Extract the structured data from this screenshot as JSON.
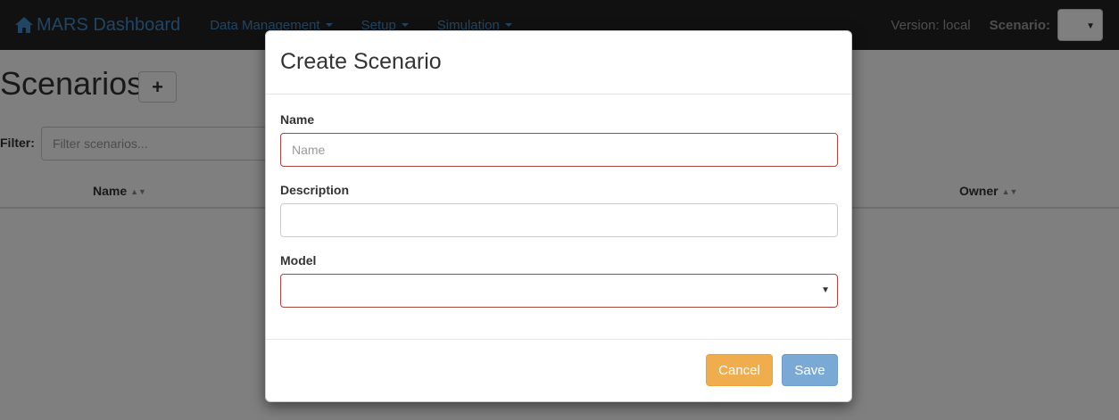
{
  "navbar": {
    "brand": "MARS Dashboard",
    "menu": [
      {
        "label": "Data Management"
      },
      {
        "label": "Setup"
      },
      {
        "label": "Simulation"
      }
    ],
    "version": "Version: local",
    "scenario_label": "Scenario:"
  },
  "page": {
    "title": "Scenarios",
    "add_label": "+",
    "filter_label": "Filter:",
    "filter_placeholder": "Filter scenarios...",
    "columns": [
      "Name",
      "Owner"
    ]
  },
  "modal": {
    "title": "Create Scenario",
    "fields": {
      "name": {
        "label": "Name",
        "placeholder": "Name",
        "value": ""
      },
      "description": {
        "label": "Description",
        "value": ""
      },
      "model": {
        "label": "Model",
        "selected": ""
      }
    },
    "cancel_label": "Cancel",
    "save_label": "Save"
  },
  "colors": {
    "navbar_bg": "#222222",
    "link": "#428bca",
    "error_border": "#a94442",
    "cancel_button": "#f0ad4e",
    "save_button": "#7ba9d6"
  },
  "icons": {
    "brand_icon": "home-icon",
    "sort_icon": "sort-icon",
    "dropdown_icon": "caret-down-icon"
  }
}
